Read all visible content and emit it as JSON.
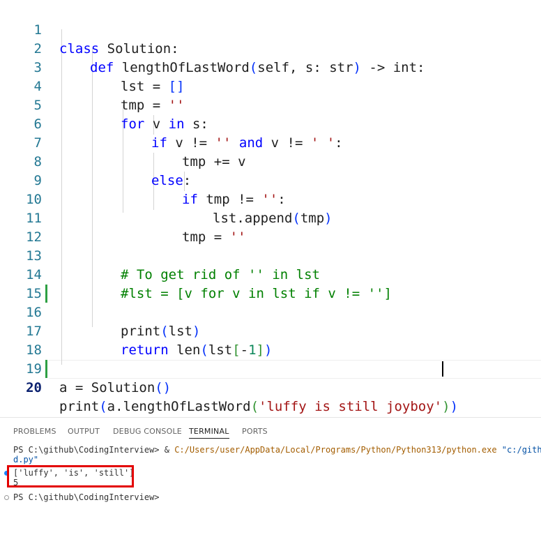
{
  "editor": {
    "line_numbers": [
      "1",
      "2",
      "3",
      "4",
      "5",
      "6",
      "7",
      "8",
      "9",
      "10",
      "11",
      "12",
      "13",
      "14",
      "15",
      "16",
      "17",
      "18",
      "19",
      "20"
    ],
    "code": {
      "l1_kw": "class",
      "l1_rest": " Solution:",
      "l2_kw": "def",
      "l2_name": " lengthOfLastWord",
      "l2_open": "(",
      "l2_params": "self, s: str",
      "l2_close": ")",
      "l2_rest": " -> int:",
      "l3_pre": "lst = ",
      "l3_list": "[]",
      "l4_pre": "tmp = ",
      "l4_str": "''",
      "l5_kw": "for",
      "l5_mid": " v ",
      "l5_kw2": "in",
      "l5_rest": " s:",
      "l6_kw": "if",
      "l6_a": " v != ",
      "l6_s1": "''",
      "l6_b": " ",
      "l6_kw2": "and",
      "l6_c": " v != ",
      "l6_s2": "' '",
      "l6_d": ":",
      "l7": "tmp += v",
      "l8_kw": "else",
      "l8_rest": ":",
      "l9_kw": "if",
      "l9_a": " tmp != ",
      "l9_s": "''",
      "l9_b": ":",
      "l10_a": "lst.append",
      "l10_open": "(",
      "l10_arg": "tmp",
      "l10_close": ")",
      "l11_pre": "tmp = ",
      "l11_str": "''",
      "l13": "# To get rid of '' in lst",
      "l14": "#lst = [v for v in lst if v != '']",
      "l16_a": "print",
      "l16_open": "(",
      "l16_arg": "lst",
      "l16_close": ")",
      "l17_kw": "return",
      "l17_a": " len",
      "l17_open": "(",
      "l17_b": "lst",
      "l17_bo": "[",
      "l17_minus": "-",
      "l17_num": "1",
      "l17_bc": "]",
      "l17_close": ")",
      "l19_a": "a = Solution",
      "l19_paren": "()",
      "l20_a": "print",
      "l20_open": "(",
      "l20_b": "a.lengthOfLastWord",
      "l20_open2": "(",
      "l20_str": "'luffy is still joyboy'",
      "l20_close2": ")",
      "l20_close": ")"
    }
  },
  "panel": {
    "tabs": [
      "PROBLEMS",
      "OUTPUT",
      "DEBUG CONSOLE",
      "TERMINAL",
      "PORTS"
    ],
    "active_tab": "TERMINAL",
    "terminal": {
      "line1_prompt": "PS C:\\github\\CodingInterview> ",
      "line1_amp": "& ",
      "line1_path": "C:/Users/user/AppData/Local/Programs/Python/Python313/python.exe",
      "line1_arg": " \"c:/github/",
      "line2": "d.py\"",
      "line3": "['luffy', 'is', 'still']",
      "line4": "5",
      "line5": "PS C:\\github\\CodingInterview>"
    }
  },
  "colors": {
    "keyword": "#0000ff",
    "control": "#af00db",
    "string": "#a31515",
    "comment": "#008000",
    "line_number": "#237893",
    "highlight_box": "#e30000"
  }
}
